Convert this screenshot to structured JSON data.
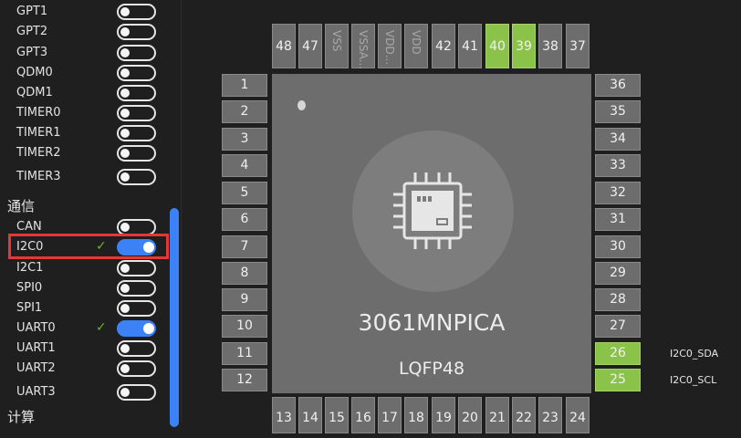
{
  "sidebar": {
    "items_a": [
      {
        "label": "GPT1",
        "on": false,
        "checked": false
      },
      {
        "label": "GPT2",
        "on": false,
        "checked": false
      },
      {
        "label": "GPT3",
        "on": false,
        "checked": false
      },
      {
        "label": "QDM0",
        "on": false,
        "checked": false
      },
      {
        "label": "QDM1",
        "on": false,
        "checked": false
      },
      {
        "label": "TIMER0",
        "on": false,
        "checked": false
      },
      {
        "label": "TIMER1",
        "on": false,
        "checked": false
      },
      {
        "label": "TIMER2",
        "on": false,
        "checked": false
      },
      {
        "label": "TIMER3",
        "on": false,
        "checked": false
      }
    ],
    "section_comm": "通信",
    "items_b": [
      {
        "label": "CAN",
        "on": false,
        "checked": false
      },
      {
        "label": "I2C0",
        "on": true,
        "checked": true
      },
      {
        "label": "I2C1",
        "on": false,
        "checked": false
      },
      {
        "label": "SPI0",
        "on": false,
        "checked": false
      },
      {
        "label": "SPI1",
        "on": false,
        "checked": false
      },
      {
        "label": "UART0",
        "on": true,
        "checked": true
      },
      {
        "label": "UART1",
        "on": false,
        "checked": false
      },
      {
        "label": "UART2",
        "on": false,
        "checked": false
      },
      {
        "label": "UART3",
        "on": false,
        "checked": false
      }
    ],
    "section_calc": "计算",
    "check_mark": "✓"
  },
  "chip": {
    "name": "3061MNPICA",
    "package": "LQFP48",
    "top_pins": [
      {
        "label": "48",
        "state": "normal"
      },
      {
        "label": "47",
        "state": "normal"
      },
      {
        "label": "VSS",
        "state": "dim"
      },
      {
        "label": "VSSA...",
        "state": "dim"
      },
      {
        "label": "VDD...",
        "state": "dim"
      },
      {
        "label": "VDD",
        "state": "dim"
      },
      {
        "label": "42",
        "state": "normal"
      },
      {
        "label": "41",
        "state": "normal"
      },
      {
        "label": "40",
        "state": "green"
      },
      {
        "label": "39",
        "state": "green"
      },
      {
        "label": "38",
        "state": "normal"
      },
      {
        "label": "37",
        "state": "normal"
      }
    ],
    "left_pins": [
      "1",
      "2",
      "3",
      "4",
      "5",
      "6",
      "7",
      "8",
      "9",
      "10",
      "11",
      "12"
    ],
    "right_pins": [
      {
        "label": "36",
        "state": "normal",
        "signal": ""
      },
      {
        "label": "35",
        "state": "normal",
        "signal": ""
      },
      {
        "label": "34",
        "state": "normal",
        "signal": ""
      },
      {
        "label": "33",
        "state": "normal",
        "signal": ""
      },
      {
        "label": "32",
        "state": "normal",
        "signal": ""
      },
      {
        "label": "31",
        "state": "normal",
        "signal": ""
      },
      {
        "label": "30",
        "state": "normal",
        "signal": ""
      },
      {
        "label": "29",
        "state": "normal",
        "signal": ""
      },
      {
        "label": "28",
        "state": "normal",
        "signal": ""
      },
      {
        "label": "27",
        "state": "normal",
        "signal": ""
      },
      {
        "label": "26",
        "state": "green",
        "signal": "I2C0_SDA"
      },
      {
        "label": "25",
        "state": "green",
        "signal": "I2C0_SCL"
      }
    ],
    "bottom_pins": [
      "13",
      "14",
      "15",
      "16",
      "17",
      "18",
      "19",
      "20",
      "21",
      "22",
      "23",
      "24"
    ]
  },
  "colors": {
    "accent": "#3b82f6",
    "pin_active": "#8bc34a",
    "highlight": "#e83535",
    "check": "#67b62b"
  }
}
